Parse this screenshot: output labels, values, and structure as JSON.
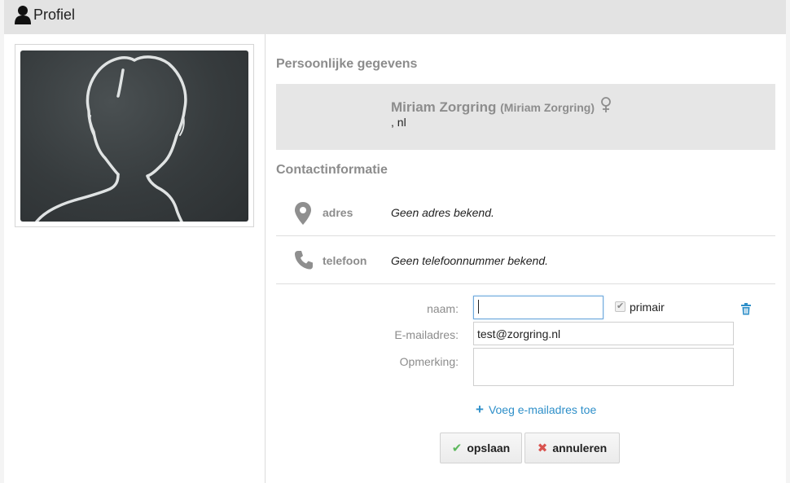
{
  "header": {
    "title": "Profiel",
    "icon": "user-icon"
  },
  "profile_photo": {
    "icon": "silhouette-avatar"
  },
  "personal": {
    "section_title": "Persoonlijke gegevens",
    "name": "Miriam Zorgring",
    "alias": "(Miriam Zorgring)",
    "gender_icon": "female-icon",
    "location": ", nl"
  },
  "contact": {
    "section_title": "Contactinformatie",
    "rows": [
      {
        "icon": "map-marker-icon",
        "label": "adres",
        "value": "Geen adres bekend."
      },
      {
        "icon": "phone-icon",
        "label": "telefoon",
        "value": "Geen telefoonnummer bekend."
      }
    ]
  },
  "email_form": {
    "name_label": "naam:",
    "name_value": "",
    "primary_label": "primair",
    "primary_checked": true,
    "email_label": "E-mailadres:",
    "email_value": "test@zorgring.nl",
    "remark_label": "Opmerking:",
    "remark_value": "",
    "add_link": "Voeg e-mailadres toe"
  },
  "actions": {
    "save": "opslaan",
    "cancel": "annuleren"
  },
  "colors": {
    "header_bg": "#e3e3e3",
    "muted_text": "#8c8c8c",
    "link": "#2e8fc9",
    "success": "#5cb85c",
    "danger": "#d9534f"
  }
}
